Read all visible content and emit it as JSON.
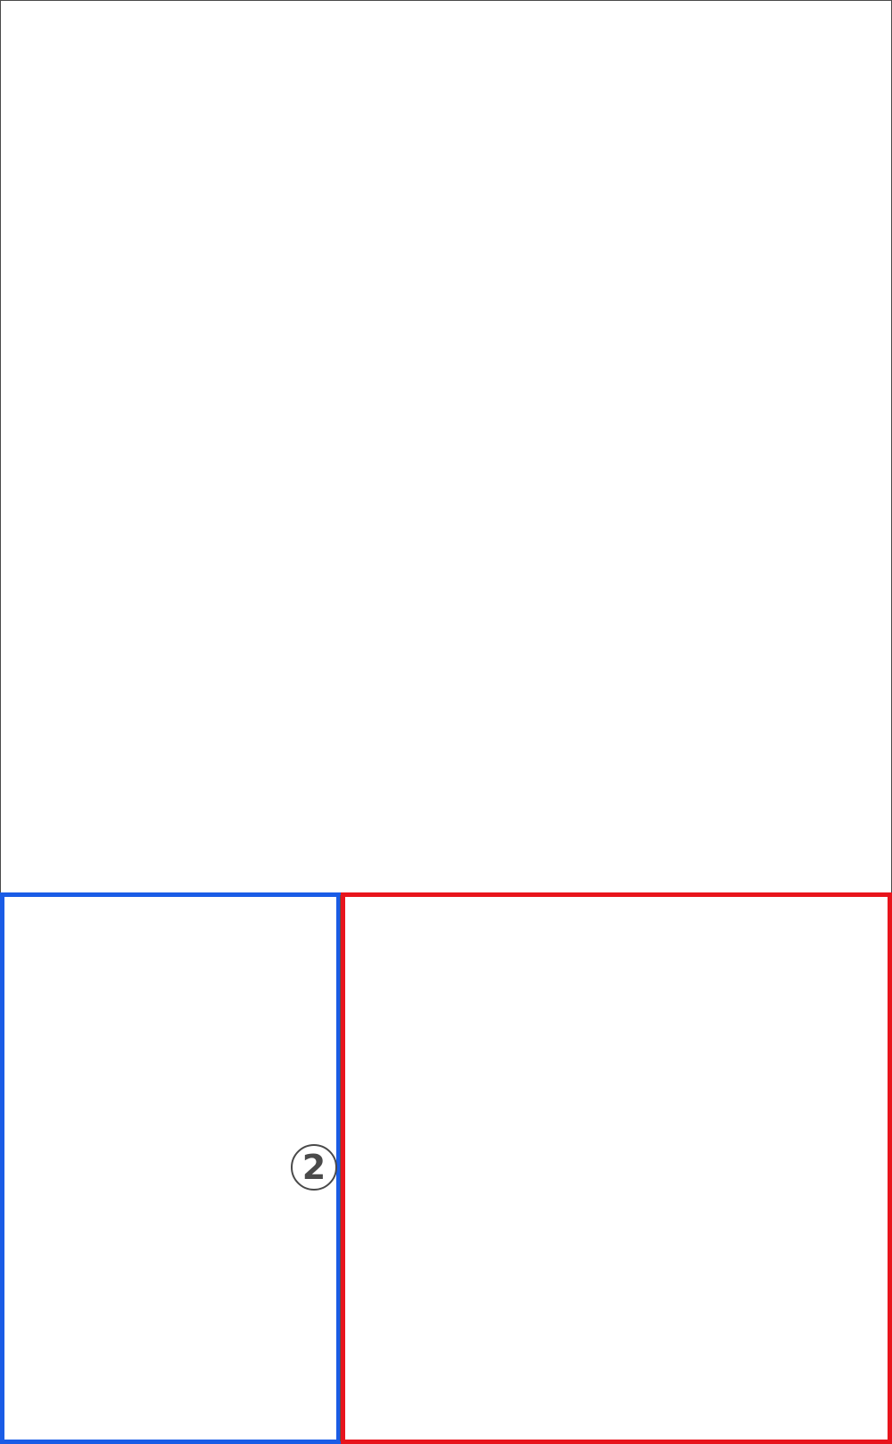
{
  "diagram": {
    "marker": {
      "label": "2"
    },
    "colors": {
      "frame": "#4a4a4a",
      "left_box_border": "#1a5ce6",
      "right_box_border": "#e8141c",
      "divider": "#555555",
      "marker_text": "#4a4a4a"
    }
  }
}
